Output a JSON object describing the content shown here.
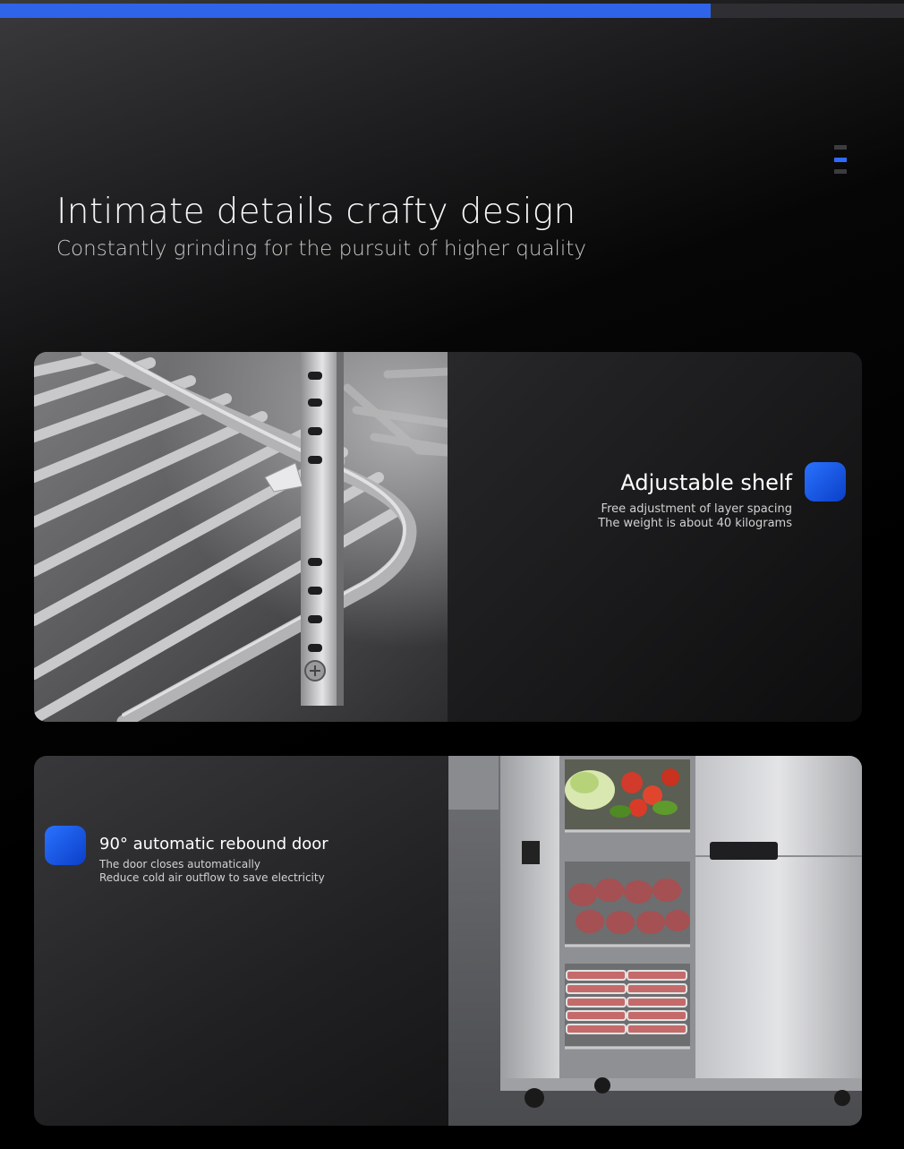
{
  "header": {
    "title": "Intimate details crafty design",
    "subtitle": "Constantly grinding for the pursuit of higher quality"
  },
  "scroll_progress": 0.786,
  "colors": {
    "accent": "#2f63e8",
    "badge": "#1f5ef0",
    "background": "#000000"
  },
  "menu": {
    "icon": "menu-icon"
  },
  "features": [
    {
      "title": "Adjustable shelf",
      "lines": [
        "Free adjustment of layer spacing",
        "The weight is about 40 kilograms"
      ],
      "image": "stainless wire shelf with adjustable rail"
    },
    {
      "title": "90° automatic rebound door",
      "lines": [
        "The door closes automatically",
        "Reduce cold air outflow to save electricity"
      ],
      "image": "stainless refrigerator with open door showing vegetables and meat"
    }
  ]
}
